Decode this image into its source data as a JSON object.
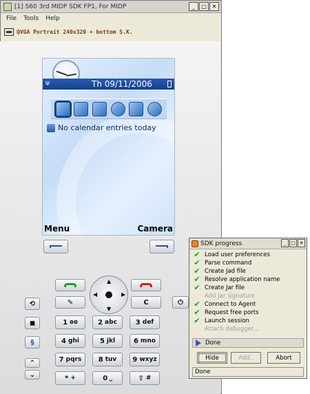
{
  "emulator": {
    "title": "[1] S60 3rd MIDP SDK FP1, For MIDP",
    "menu": [
      "File",
      "Tools",
      "Help"
    ],
    "config_label": "QVGA  Portrait  240x320  + bottom S.K."
  },
  "screen": {
    "date": "Th 09/11/2006",
    "calendar_text": "No calendar entries today",
    "softkey_left": "Menu",
    "softkey_right": "Camera",
    "shortcut_icons": [
      "inbox-icon",
      "calendar-icon",
      "web-icon",
      "globe-icon",
      "notes-icon",
      "clock-icon"
    ]
  },
  "keypad": {
    "keys": [
      {
        "digit": "1",
        "letters": "ᴑᴑ"
      },
      {
        "digit": "2",
        "letters": "abc"
      },
      {
        "digit": "3",
        "letters": "def"
      },
      {
        "digit": "4",
        "letters": "ghi"
      },
      {
        "digit": "5",
        "letters": "jkl"
      },
      {
        "digit": "6",
        "letters": "mno"
      },
      {
        "digit": "7",
        "letters": "pqrs"
      },
      {
        "digit": "8",
        "letters": "tuv"
      },
      {
        "digit": "9",
        "letters": "wxyz"
      },
      {
        "digit": "*",
        "letters": "+"
      },
      {
        "digit": "0",
        "letters": "⎵"
      },
      {
        "digit": "⇧",
        "letters": "#"
      }
    ],
    "clear_label": "C"
  },
  "sdk_dialog": {
    "title": "SDK progress",
    "steps": [
      {
        "label": "Load user preferences",
        "status": "done"
      },
      {
        "label": "Parse command",
        "status": "done"
      },
      {
        "label": "Create Jad file",
        "status": "done"
      },
      {
        "label": "Resolve application name",
        "status": "done"
      },
      {
        "label": "Create Jar file",
        "status": "done"
      },
      {
        "label": "Add Jar signature",
        "status": "pending"
      },
      {
        "label": "Connect to Agent",
        "status": "done"
      },
      {
        "label": "Request free ports",
        "status": "done"
      },
      {
        "label": "Launch session",
        "status": "done"
      },
      {
        "label": "Attach debugger...",
        "status": "pending"
      }
    ],
    "done_label": "Done",
    "hide_label": "Hide",
    "add_label": "Add..",
    "abort_label": "Abort",
    "status_text": "Done"
  },
  "colors": {
    "check": "#1aa01a",
    "date_bar": "#1d4f9e",
    "config_text": "#7a3a10"
  }
}
